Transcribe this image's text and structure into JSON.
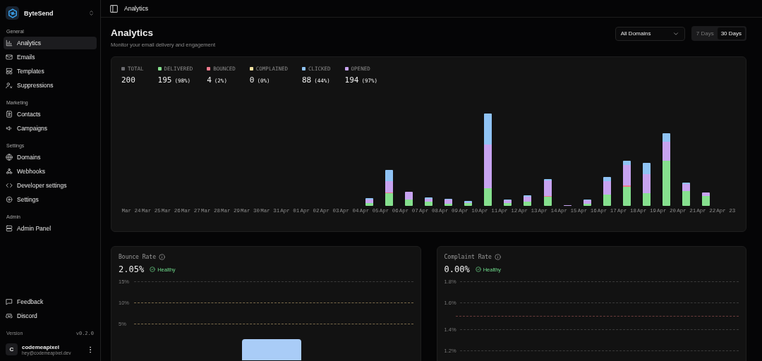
{
  "sidebar": {
    "workspace": "ByteSend",
    "groups": [
      {
        "title": "General",
        "items": [
          {
            "label": "Analytics",
            "selected": true
          },
          {
            "label": "Emails",
            "selected": false
          },
          {
            "label": "Templates",
            "selected": false
          },
          {
            "label": "Suppressions",
            "selected": false
          }
        ]
      },
      {
        "title": "Marketing",
        "items": [
          {
            "label": "Contacts",
            "selected": false
          },
          {
            "label": "Campaigns",
            "selected": false
          }
        ]
      },
      {
        "title": "Settings",
        "items": [
          {
            "label": "Domains",
            "selected": false
          },
          {
            "label": "Webhooks",
            "selected": false
          },
          {
            "label": "Developer settings",
            "selected": false
          },
          {
            "label": "Settings",
            "selected": false
          }
        ]
      },
      {
        "title": "Admin",
        "items": [
          {
            "label": "Admin Panel",
            "selected": false
          }
        ]
      }
    ],
    "footer_items": [
      {
        "label": "Feedback"
      },
      {
        "label": "Discord"
      }
    ],
    "version_label": "Version",
    "version": "v0.2.0",
    "user": {
      "initial": "C",
      "name": "codemeapixel",
      "email": "hey@codemeapixel.dev"
    }
  },
  "topbar": {
    "title": "Analytics"
  },
  "header": {
    "title": "Analytics",
    "subtitle": "Monitor your email delivery and engagement",
    "domain_select": "All Domains",
    "ranges": [
      {
        "label": "7 Days",
        "selected": false
      },
      {
        "label": "30 Days",
        "selected": true
      }
    ]
  },
  "stats": [
    {
      "label": "TOTAL",
      "value": "200",
      "color": "#6b6b70"
    },
    {
      "label": "DELIVERED",
      "value": "195",
      "percent": "(98%)",
      "color": "#86e08e"
    },
    {
      "label": "BOUNCED",
      "value": "4",
      "percent": "(2%)",
      "color": "#f07a8c"
    },
    {
      "label": "COMPLAINED",
      "value": "0",
      "percent": "(0%)",
      "color": "#f5e1a0"
    },
    {
      "label": "CLICKED",
      "value": "88",
      "percent": "(44%)",
      "color": "#8fc3f5"
    },
    {
      "label": "OPENED",
      "value": "194",
      "percent": "(97%)",
      "color": "#c7a3f0"
    }
  ],
  "activity_chart": {
    "dates": [
      "Mar 24",
      "Mar 25",
      "Mar 26",
      "Mar 27",
      "Mar 28",
      "Mar 29",
      "Mar 30",
      "Mar 31",
      "Apr 01",
      "Apr 02",
      "Apr 03",
      "Apr 04",
      "Apr 05",
      "Apr 06",
      "Apr 07",
      "Apr 08",
      "Apr 09",
      "Apr 10",
      "Apr 11",
      "Apr 12",
      "Apr 13",
      "Apr 14",
      "Apr 15",
      "Apr 16",
      "Apr 17",
      "Apr 18",
      "Apr 19",
      "Apr 20",
      "Apr 21",
      "Apr 22",
      "Apr 23"
    ]
  },
  "rate_cards": [
    {
      "title": "Bounce Rate",
      "value": "2.05%",
      "status": "Healthy",
      "yticks": [
        "15%",
        "10%",
        "5%"
      ]
    },
    {
      "title": "Complaint Rate",
      "value": "0.00%",
      "status": "Healthy",
      "yticks": [
        "1.8%",
        "1.6%",
        "1.4%",
        "1.2%"
      ]
    }
  ]
}
